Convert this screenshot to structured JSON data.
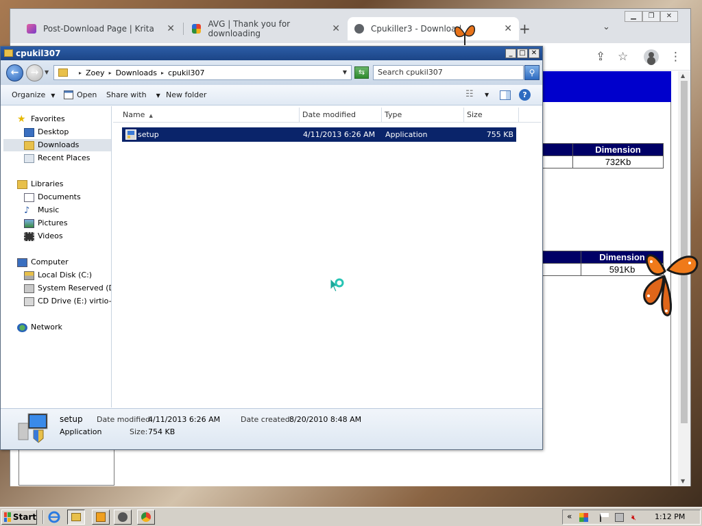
{
  "browser": {
    "tabs": [
      {
        "title": "Post-Download Page | Krita",
        "active": false
      },
      {
        "title": "AVG | Thank you for downloading",
        "active": false
      },
      {
        "title": "Cpukiller3 - Download",
        "active": true
      }
    ],
    "new_tab_symbol": "+",
    "close_symbol": "✕",
    "tables": [
      {
        "header": "Dimension",
        "value": "732Kb"
      },
      {
        "header": "Dimension",
        "value": "591Kb"
      }
    ],
    "window_controls": [
      "▁",
      "❐",
      "✕"
    ],
    "colors": {
      "banner": "#0000cc",
      "table_header": "#000066"
    }
  },
  "explorer": {
    "title": "cpukil307",
    "address": {
      "crumbs": [
        "Zoey",
        "Downloads",
        "cpukil307"
      ]
    },
    "search": {
      "placeholder": "Search cpukil307"
    },
    "commands": {
      "organize": "Organize",
      "open": "Open",
      "share_with": "Share with",
      "new_folder": "New folder"
    },
    "nav": {
      "favorites": "Favorites",
      "desktop": "Desktop",
      "downloads": "Downloads",
      "recent_places": "Recent Places",
      "libraries": "Libraries",
      "documents": "Documents",
      "music": "Music",
      "pictures": "Pictures",
      "videos": "Videos",
      "computer": "Computer",
      "local_disk": "Local Disk (C:)",
      "system_reserved": "System Reserved (D:)",
      "cd_drive": "CD Drive (E:) virtio-win",
      "network": "Network"
    },
    "columns": {
      "name": "Name",
      "date_modified": "Date modified",
      "type": "Type",
      "size": "Size"
    },
    "files": [
      {
        "name": "setup",
        "date_modified": "4/11/2013 6:26 AM",
        "type": "Application",
        "size": "755 KB",
        "selected": true
      }
    ],
    "details": {
      "name": "setup",
      "kind": "Application",
      "date_modified_label": "Date modified:",
      "date_modified": "4/11/2013 6:26 AM",
      "size_label": "Size:",
      "size": "754 KB",
      "date_created_label": "Date created:",
      "date_created": "8/20/2010 8:48 AM"
    }
  },
  "taskbar": {
    "start_label": "Start",
    "clock": "1:12 PM",
    "tray_expand": "«"
  }
}
